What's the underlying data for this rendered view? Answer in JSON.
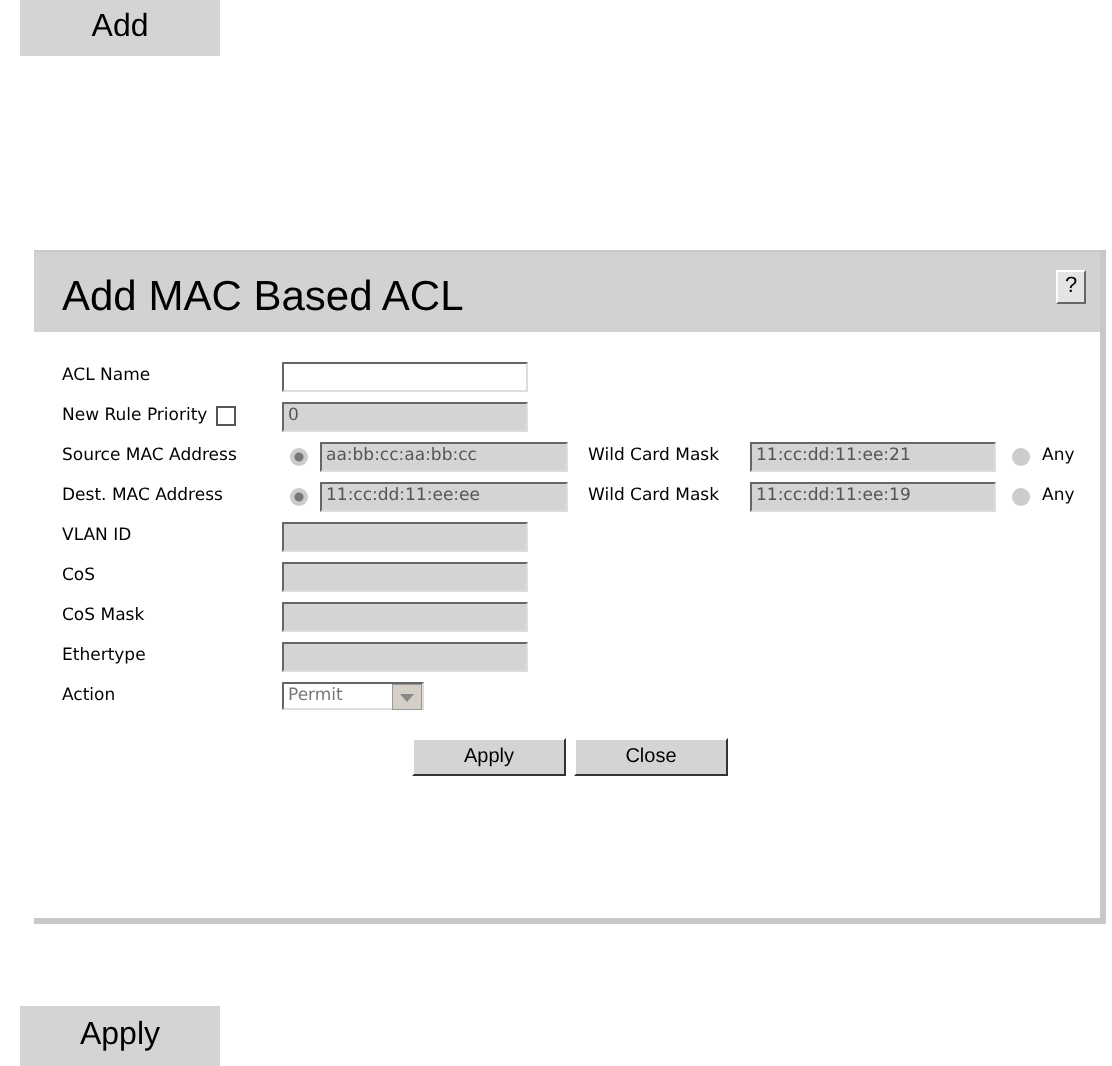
{
  "top_button": "Add",
  "dialog": {
    "title": "Add MAC Based ACL",
    "help": "?",
    "rows": [
      {
        "kind": "text",
        "label": "ACL Name",
        "value": "",
        "disabled": false
      },
      {
        "kind": "checkbox-text",
        "label": "New Rule Priority",
        "checked": false,
        "value": "0",
        "disabled": true
      },
      {
        "kind": "mac",
        "label": "Source MAC Address",
        "selected": true,
        "value": "aa:bb:cc:aa:bb:cc",
        "mask_label": "Wild Card Mask",
        "mask": "11:cc:dd:11:ee:21",
        "any_label": "Any",
        "any_selected": false
      },
      {
        "kind": "mac",
        "label": "Dest. MAC Address",
        "selected": true,
        "value": "11:cc:dd:11:ee:ee",
        "mask_label": "Wild Card Mask",
        "mask": "11:cc:dd:11:ee:19",
        "any_label": "Any",
        "any_selected": false
      },
      {
        "kind": "text",
        "label": "VLAN ID",
        "value": "",
        "disabled": true
      },
      {
        "kind": "text",
        "label": "CoS",
        "value": "",
        "disabled": true
      },
      {
        "kind": "text",
        "label": "CoS Mask",
        "value": "",
        "disabled": true
      },
      {
        "kind": "text",
        "label": "Ethertype",
        "value": "",
        "disabled": true
      },
      {
        "kind": "select",
        "label": "Action",
        "value": "Permit",
        "disabled": true
      }
    ],
    "buttons": [
      "Apply",
      "Close"
    ]
  },
  "bottom_button": "Apply"
}
